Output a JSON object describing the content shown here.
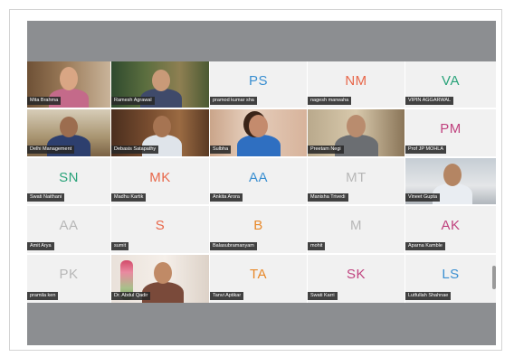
{
  "participants": [
    {
      "name": "Mita Brahma",
      "initials": "",
      "video": true
    },
    {
      "name": "Ramesh Agrawal",
      "initials": "",
      "video": true
    },
    {
      "name": "pramod kumar sha",
      "initials": "PS",
      "color": "#3a8fd1",
      "video": false
    },
    {
      "name": "nagesh marwaha",
      "initials": "NM",
      "color": "#e8674a",
      "video": false
    },
    {
      "name": "VIPIN AGGARWAL",
      "initials": "VA",
      "color": "#2aa37a",
      "video": false
    },
    {
      "name": "Delhi Management",
      "initials": "",
      "video": true
    },
    {
      "name": "Debasis Satapathy",
      "initials": "",
      "video": true
    },
    {
      "name": "Sulbha",
      "initials": "",
      "video": true
    },
    {
      "name": "Preetam Negi",
      "initials": "",
      "video": true
    },
    {
      "name": "Prof JP MOHLA",
      "initials": "PM",
      "color": "#c0437f",
      "video": false
    },
    {
      "name": "Swati Naithani",
      "initials": "SN",
      "color": "#2aa37a",
      "video": false
    },
    {
      "name": "Madhu Kartik",
      "initials": "MK",
      "color": "#e8674a",
      "video": false
    },
    {
      "name": "Ankita Arora",
      "initials": "AA",
      "color": "#3a8fd1",
      "video": false
    },
    {
      "name": "Manisha Trivedi",
      "initials": "MT",
      "color": "#b7b7b7",
      "video": false
    },
    {
      "name": "Vineet Gupta",
      "initials": "",
      "video": true
    },
    {
      "name": "Amit Arya",
      "initials": "AA",
      "color": "#b7b7b7",
      "video": false
    },
    {
      "name": "sumit",
      "initials": "S",
      "color": "#e8674a",
      "video": false
    },
    {
      "name": "Balasubramanyam",
      "initials": "B",
      "color": "#e8892a",
      "video": false
    },
    {
      "name": "mohit",
      "initials": "M",
      "color": "#b7b7b7",
      "video": false
    },
    {
      "name": "Aparna Kamble",
      "initials": "AK",
      "color": "#c0437f",
      "video": false
    },
    {
      "name": "pramila ken",
      "initials": "PK",
      "color": "#b7b7b7",
      "video": false
    },
    {
      "name": "Dr. Abdul Qadir",
      "initials": "",
      "video": true
    },
    {
      "name": "Tanvi Aptikar",
      "initials": "TA",
      "color": "#e8892a",
      "video": false
    },
    {
      "name": "Swati Karri",
      "initials": "SK",
      "color": "#c0437f",
      "video": false
    },
    {
      "name": "Lutfullah Shahnae",
      "initials": "LS",
      "color": "#3a8fd1",
      "video": false
    }
  ]
}
